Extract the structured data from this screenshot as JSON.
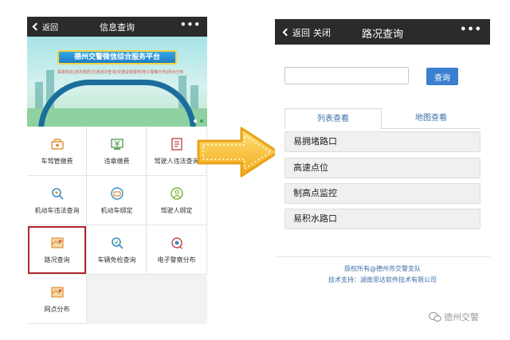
{
  "left_screen": {
    "header": {
      "back_label": "返回",
      "title": "信息查询",
      "more_label": "•••"
    },
    "banner": {
      "title": "德州交警微信综合服务平台",
      "subtitle": "事故快处|违法缴费|交通违法查询|交通设施报修|电子警察分布|网点分布"
    },
    "grid_items": [
      {
        "label": "车驾管缴费",
        "icon": "vehicle-fee-icon"
      },
      {
        "label": "违章缴费",
        "icon": "yuan-payment-icon"
      },
      {
        "label": "驾驶人违法查询",
        "icon": "driver-violation-doc-icon"
      },
      {
        "label": "机动车违法查询",
        "icon": "vehicle-violation-search-icon"
      },
      {
        "label": "机动车绑定",
        "icon": "vehicle-bind-icon"
      },
      {
        "label": "驾驶人绑定",
        "icon": "driver-bind-icon"
      },
      {
        "label": "路况查询",
        "icon": "road-map-icon"
      },
      {
        "label": "车辆免检查询",
        "icon": "vehicle-exempt-search-icon"
      },
      {
        "label": "电子警察分布",
        "icon": "camera-distribution-icon"
      },
      {
        "label": "网点分布",
        "icon": "outlet-map-icon"
      }
    ],
    "highlighted_item": "路况查询"
  },
  "right_screen": {
    "header": {
      "back_label": "返回",
      "close_label": "关闭",
      "title": "路况查询",
      "more_label": "•••"
    },
    "search": {
      "value": "",
      "placeholder": "",
      "button_label": "查询"
    },
    "tabs": [
      {
        "label": "列表查看",
        "active": true
      },
      {
        "label": "地图查看",
        "active": false
      }
    ],
    "list_items": [
      "易拥堵路口",
      "高速点位",
      "制高点监控",
      "易积水路口"
    ],
    "footer": {
      "copyright": "版权所有@德州市交警支队",
      "tech_support": "技术支持：湖南思达软件技术有限公司"
    }
  },
  "watermark": {
    "text": "德州交警"
  },
  "colors": {
    "navbar": "#2b2b2b",
    "highlight_border": "#b0282c",
    "primary_button": "#3b80d0",
    "link_text": "#3b6fa8",
    "arrow_fill": "#f6b820",
    "icon_orange": "#e0913a"
  }
}
